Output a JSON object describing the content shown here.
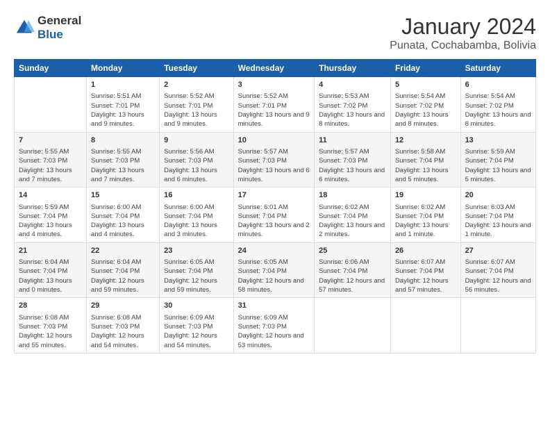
{
  "logo": {
    "general": "General",
    "blue": "Blue"
  },
  "title": "January 2024",
  "subtitle": "Punata, Cochabamba, Bolivia",
  "days_header": [
    "Sunday",
    "Monday",
    "Tuesday",
    "Wednesday",
    "Thursday",
    "Friday",
    "Saturday"
  ],
  "weeks": [
    [
      {
        "num": "",
        "sunrise": "",
        "sunset": "",
        "daylight": ""
      },
      {
        "num": "1",
        "sunrise": "5:51 AM",
        "sunset": "7:01 PM",
        "daylight": "13 hours and 9 minutes."
      },
      {
        "num": "2",
        "sunrise": "5:52 AM",
        "sunset": "7:01 PM",
        "daylight": "13 hours and 9 minutes."
      },
      {
        "num": "3",
        "sunrise": "5:52 AM",
        "sunset": "7:01 PM",
        "daylight": "13 hours and 9 minutes."
      },
      {
        "num": "4",
        "sunrise": "5:53 AM",
        "sunset": "7:02 PM",
        "daylight": "13 hours and 8 minutes."
      },
      {
        "num": "5",
        "sunrise": "5:54 AM",
        "sunset": "7:02 PM",
        "daylight": "13 hours and 8 minutes."
      },
      {
        "num": "6",
        "sunrise": "5:54 AM",
        "sunset": "7:02 PM",
        "daylight": "13 hours and 8 minutes."
      }
    ],
    [
      {
        "num": "7",
        "sunrise": "5:55 AM",
        "sunset": "7:03 PM",
        "daylight": "13 hours and 7 minutes."
      },
      {
        "num": "8",
        "sunrise": "5:55 AM",
        "sunset": "7:03 PM",
        "daylight": "13 hours and 7 minutes."
      },
      {
        "num": "9",
        "sunrise": "5:56 AM",
        "sunset": "7:03 PM",
        "daylight": "13 hours and 6 minutes."
      },
      {
        "num": "10",
        "sunrise": "5:57 AM",
        "sunset": "7:03 PM",
        "daylight": "13 hours and 6 minutes."
      },
      {
        "num": "11",
        "sunrise": "5:57 AM",
        "sunset": "7:03 PM",
        "daylight": "13 hours and 6 minutes."
      },
      {
        "num": "12",
        "sunrise": "5:58 AM",
        "sunset": "7:04 PM",
        "daylight": "13 hours and 5 minutes."
      },
      {
        "num": "13",
        "sunrise": "5:59 AM",
        "sunset": "7:04 PM",
        "daylight": "13 hours and 5 minutes."
      }
    ],
    [
      {
        "num": "14",
        "sunrise": "5:59 AM",
        "sunset": "7:04 PM",
        "daylight": "13 hours and 4 minutes."
      },
      {
        "num": "15",
        "sunrise": "6:00 AM",
        "sunset": "7:04 PM",
        "daylight": "13 hours and 4 minutes."
      },
      {
        "num": "16",
        "sunrise": "6:00 AM",
        "sunset": "7:04 PM",
        "daylight": "13 hours and 3 minutes."
      },
      {
        "num": "17",
        "sunrise": "6:01 AM",
        "sunset": "7:04 PM",
        "daylight": "13 hours and 2 minutes."
      },
      {
        "num": "18",
        "sunrise": "6:02 AM",
        "sunset": "7:04 PM",
        "daylight": "13 hours and 2 minutes."
      },
      {
        "num": "19",
        "sunrise": "6:02 AM",
        "sunset": "7:04 PM",
        "daylight": "13 hours and 1 minute."
      },
      {
        "num": "20",
        "sunrise": "6:03 AM",
        "sunset": "7:04 PM",
        "daylight": "13 hours and 1 minute."
      }
    ],
    [
      {
        "num": "21",
        "sunrise": "6:04 AM",
        "sunset": "7:04 PM",
        "daylight": "13 hours and 0 minutes."
      },
      {
        "num": "22",
        "sunrise": "6:04 AM",
        "sunset": "7:04 PM",
        "daylight": "12 hours and 59 minutes."
      },
      {
        "num": "23",
        "sunrise": "6:05 AM",
        "sunset": "7:04 PM",
        "daylight": "12 hours and 59 minutes."
      },
      {
        "num": "24",
        "sunrise": "6:05 AM",
        "sunset": "7:04 PM",
        "daylight": "12 hours and 58 minutes."
      },
      {
        "num": "25",
        "sunrise": "6:06 AM",
        "sunset": "7:04 PM",
        "daylight": "12 hours and 57 minutes."
      },
      {
        "num": "26",
        "sunrise": "6:07 AM",
        "sunset": "7:04 PM",
        "daylight": "12 hours and 57 minutes."
      },
      {
        "num": "27",
        "sunrise": "6:07 AM",
        "sunset": "7:04 PM",
        "daylight": "12 hours and 56 minutes."
      }
    ],
    [
      {
        "num": "28",
        "sunrise": "6:08 AM",
        "sunset": "7:03 PM",
        "daylight": "12 hours and 55 minutes."
      },
      {
        "num": "29",
        "sunrise": "6:08 AM",
        "sunset": "7:03 PM",
        "daylight": "12 hours and 54 minutes."
      },
      {
        "num": "30",
        "sunrise": "6:09 AM",
        "sunset": "7:03 PM",
        "daylight": "12 hours and 54 minutes."
      },
      {
        "num": "31",
        "sunrise": "6:09 AM",
        "sunset": "7:03 PM",
        "daylight": "12 hours and 53 minutes."
      },
      {
        "num": "",
        "sunrise": "",
        "sunset": "",
        "daylight": ""
      },
      {
        "num": "",
        "sunrise": "",
        "sunset": "",
        "daylight": ""
      },
      {
        "num": "",
        "sunrise": "",
        "sunset": "",
        "daylight": ""
      }
    ]
  ]
}
